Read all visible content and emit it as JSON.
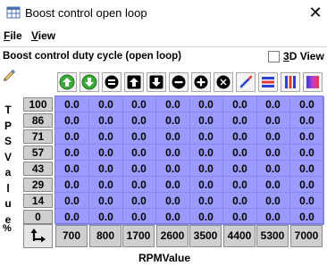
{
  "window": {
    "title": "Boost control open loop",
    "close_glyph": "✕",
    "app_icon": "table-icon"
  },
  "menu": [
    {
      "label_underline": "F",
      "label_rest": "ile"
    },
    {
      "label_underline": "V",
      "label_rest": "iew"
    }
  ],
  "panel": {
    "title": "Boost control duty cycle (open loop)",
    "view3d": {
      "label_underline": "3",
      "label_rest": "D View",
      "checked": false
    }
  },
  "toolbar_icons": [
    "increase-green-icon",
    "decrease-green-icon",
    "set-value-icon",
    "shift-up-icon",
    "shift-down-icon",
    "minus-icon",
    "plus-icon",
    "multiply-icon",
    "interpolate-icon",
    "fill-horizontal-icon",
    "fill-vertical-icon",
    "gradient-icon"
  ],
  "y_axis": {
    "label_chars": [
      "T",
      "P",
      "S",
      "V",
      "a",
      "l",
      "u",
      "e"
    ],
    "unit": "%",
    "values": [
      "100",
      "86",
      "71",
      "57",
      "43",
      "29",
      "14",
      "0"
    ]
  },
  "x_axis": {
    "label": "RPMValue",
    "values": [
      "700",
      "800",
      "1700",
      "2600",
      "3500",
      "4400",
      "5300",
      "7000"
    ]
  },
  "table": {
    "rows": [
      [
        "0.0",
        "0.0",
        "0.0",
        "0.0",
        "0.0",
        "0.0",
        "0.0",
        "0.0"
      ],
      [
        "0.0",
        "0.0",
        "0.0",
        "0.0",
        "0.0",
        "0.0",
        "0.0",
        "0.0"
      ],
      [
        "0.0",
        "0.0",
        "0.0",
        "0.0",
        "0.0",
        "0.0",
        "0.0",
        "0.0"
      ],
      [
        "0.0",
        "0.0",
        "0.0",
        "0.0",
        "0.0",
        "0.0",
        "0.0",
        "0.0"
      ],
      [
        "0.0",
        "0.0",
        "0.0",
        "0.0",
        "0.0",
        "0.0",
        "0.0",
        "0.0"
      ],
      [
        "0.0",
        "0.0",
        "0.0",
        "0.0",
        "0.0",
        "0.0",
        "0.0",
        "0.0"
      ],
      [
        "0.0",
        "0.0",
        "0.0",
        "0.0",
        "0.0",
        "0.0",
        "0.0",
        "0.0"
      ],
      [
        "0.0",
        "0.0",
        "0.0",
        "0.0",
        "0.0",
        "0.0",
        "0.0",
        "0.0"
      ]
    ]
  },
  "colors": {
    "cell_bg": "#9a9aff",
    "header_bg": "#cfcfcf",
    "green_button": "#3aa83a"
  }
}
